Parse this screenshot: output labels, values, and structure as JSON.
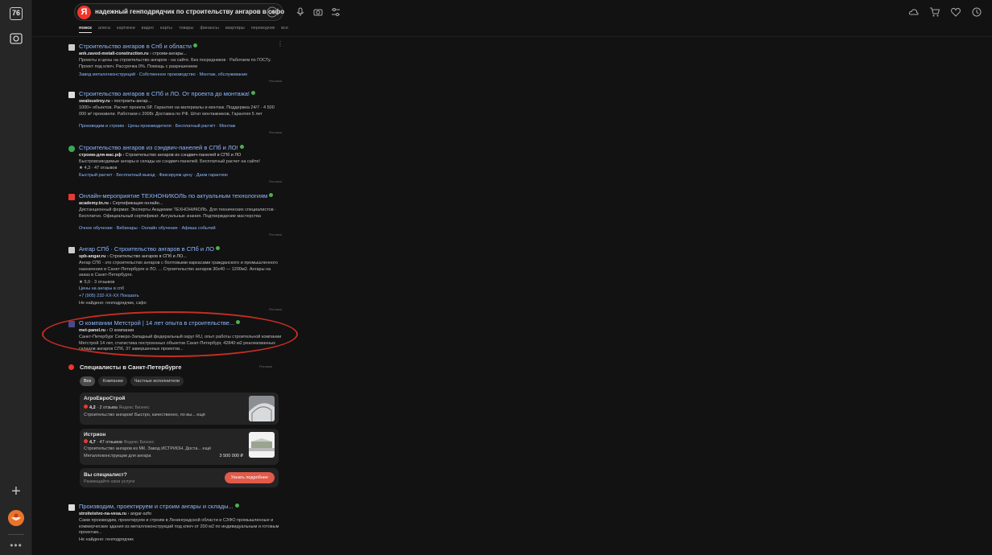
{
  "sidebar": {
    "badge": "76",
    "plus": "+",
    "more": "•••"
  },
  "search": {
    "logo": "Я",
    "query": "надежный генподрядчик по строительству ангаров в сзфо"
  },
  "tabs": [
    "поиск",
    "алиса",
    "картинки",
    "видео",
    "карты",
    "товары",
    "финансы",
    "квартиры",
    "переводчик",
    "все"
  ],
  "results": [
    {
      "title": "Строительство ангаров в Спб и области",
      "url_host": "ank.zavod-metall-construction.ru",
      "url_path": " › строим-ангары...",
      "snippet": "Проекты и цены на строительство ангаров - на сайте. Без посредников · Работаем по ГОСТу. Проект под ключ. Рассрочка 0%. Помощь с разрешением",
      "links": "Завод металлоконструкций  ·  Собственное производство  ·  Монтаж, обслуживание",
      "adv": "Реклама",
      "fav_color": "#cccccc"
    },
    {
      "title": "Строительство ангаров в СПб и ЛО. От проекта до монтажа!",
      "url_host": "swaloustroy.ru",
      "url_path": " › построить-ангар...",
      "snippet": "1000+ объектов. Расчет проекта 0₽. Гарантия на материалы и монтаж. Поддержка 24/7 · 4 500 000 м² произвели. Работаем с 2008г. Доставка по РФ. Штат монтажников, Гарантия 5 лет",
      "links": "Производим и строим  ·  Цены производителя  ·  Бесплатный расчёт  ·  Монтаж",
      "adv": "Реклама",
      "fav_color": "#dddddd"
    },
    {
      "title": "Строительство ангаров из сэндвич-панелей в СПб и ЛО!",
      "url_host": "строим-для-вас.рф",
      "url_path": " › Строительство ангаров из сэндвич-панелей в СПб и ЛО",
      "snippet": "Быстровозводимые ангары и склады из сэндвич-панелей. Бесплатный расчет на сайте!",
      "rating": "★ 4,3 · 47 отзывов",
      "links": "Быстрый расчет  ·  Бесплатный выезд  ·  Фиксируем цену  ·  Даем гарантию",
      "adv": "Реклама",
      "fav_color": "#3aa757"
    },
    {
      "title": "Онлайн-мероприятие ТЕХНОНИКОЛЬ по актуальным технологиям",
      "url_host": "academy.tn.ru",
      "url_path": " › Сертификация онлайн...",
      "snippet": "Дистанционный формат. Эксперты Академии ТЕХНОНИКОЛЬ. Для технических специалистов · Бесплатно. Официальный сертификат. Актуальные знания. Подтверждение мастерства",
      "links": "Очное обучение  ·  Вебинары  ·  Онлайн обучение  ·  Афиша событий",
      "adv": "Реклама",
      "fav_color": "#e53935"
    },
    {
      "title": "Ангар СПб · Строительство ангаров в СПб и ЛО",
      "url_host": "spb-angar.ru",
      "url_path": " › Строительство ангаров в СПб и ЛО...",
      "snippet": "Ангар СПб - это строительство ангаров с болтовыми каркасами гражданского и промышленного назначения в Санкт-Петербурге и ЛО. ... Строительство ангаров 30х40 — 1200м2. Ангары на заказ в Санкт-Петербурге.",
      "rating": "★ 5,0 · 3 отзывов",
      "links": "Цены на ангары в спб",
      "phone": "+7 (905) 232-XX-XX Показать",
      "missing": "Не найдено: генподрядчик, сзфо",
      "adv": "Реклама",
      "fav_color": "#cccccc"
    },
    {
      "title": "О компании Метстрой | 14 лет опыта в строительстве...",
      "url_host": "met-panel.ru",
      "url_path": " › О компании",
      "snippet": "Санкт-Петербург Северо-Западный федеральный округ RU, опыт работы строительной компании Метстрой 14 лет, статистика построенных объектов Санкт-Петербург, 42840 м2 реализованных складов ангаров СПб, 37 завершенных проектов...",
      "fav_color": "#4a4a8a"
    },
    {
      "title": "Производим, проектируем и строим ангары и склады...",
      "url_host": "stroiteistvo-na-vesa.ru",
      "url_path": " › angar-szfo",
      "snippet": "Сами производим, проектируем и строим в Ленинградской области и СЗФО промышленные и коммерческие здания из металлоконструкций под ключ от 200 м2 по индивидуальным и готовым проектам...",
      "missing": "Не найдено: генподрядчик",
      "fav_color": "#dddddd"
    }
  ],
  "specialists": {
    "title": "Специалисты в Санкт-Петербурге",
    "adv": "Реклама",
    "chips": [
      "Все",
      "Компании",
      "Частные исполнители"
    ],
    "cards": [
      {
        "name": "АгроЕвроСтрой",
        "rating": "4,2",
        "reviews": "· 2 отзыва",
        "source": "Яндекс Бизнес",
        "desc": "Строительство ангаров! Быстро, качественно, по вы... ещё"
      },
      {
        "name": "Истрион",
        "rating": "4,7",
        "reviews": "· 47 отзывов",
        "source": "Яндекс Бизнес",
        "desc": "Строительство ангаров из МК. Завод ИСТРИОН. Доста... ещё",
        "service": "Металлоконструкции для ангара",
        "price": "3 500 000 ₽"
      }
    ],
    "cta": {
      "question": "Вы специалист?",
      "sub": "Размещайте свои услуги",
      "button": "Узнать подробнее"
    }
  },
  "colors": {
    "background": "#121212",
    "link": "#8fb8ff",
    "brand_red": "#f0362b",
    "highlight_oval": "#c62d22",
    "verified": "#4caf50"
  }
}
